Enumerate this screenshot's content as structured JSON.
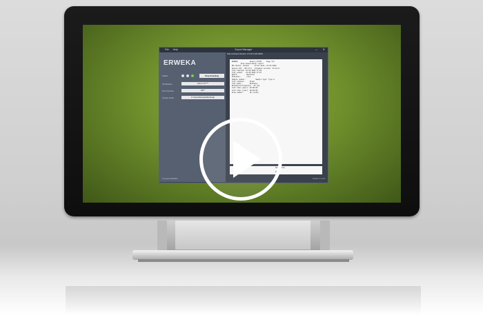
{
  "app": {
    "menu": [
      "File",
      "Help"
    ],
    "window_title": "Export Manager",
    "controls": [
      "—",
      "✕"
    ],
    "logo": "ERWEKA",
    "fields": [
      {
        "label": "Status",
        "value": ""
      },
      {
        "label": "IP Address",
        "value": "192.17.8.***"
      },
      {
        "label": "Port Number",
        "value": "80**"
      },
      {
        "label": "Output folder",
        "value": "C:\\Users\\Erweka\\Desktop"
      }
    ],
    "stop_button": "Stop listening",
    "copyright": "Copyright ERWEKA",
    "version": "Version: 1.1.0.0",
    "path_text": "Data via Export-Service: 172.16.0.132:10002",
    "report_lines": [
      "ERWEKA            Device 87730     Page 1/1",
      "         Drop measurement report",
      "DR status: locked      Print date: 21.06.2022",
      "Device 87t - DR 17-S   Firmware version: 21.12.0",
      "",
      "Test started: 21.06.2022 17:03",
      "Test ended:   21.06.2022 17:07",
      "",
      "Batch:         Bastonne",
      "Stations:      none",
      "Sample number:          Sample type: Type A",
      "",
      "Test station:     Drums",
      "Test mode:        Rotation",
      "Rotations/frequency:  25 rpm",
      "Test time (spec): 04:00:00",
      "Test time (real): 00:04:00",
      "Drum number:      01 (1/26)"
    ],
    "signature_label": "Reviewed by:",
    "signature_date": "Date:"
  }
}
